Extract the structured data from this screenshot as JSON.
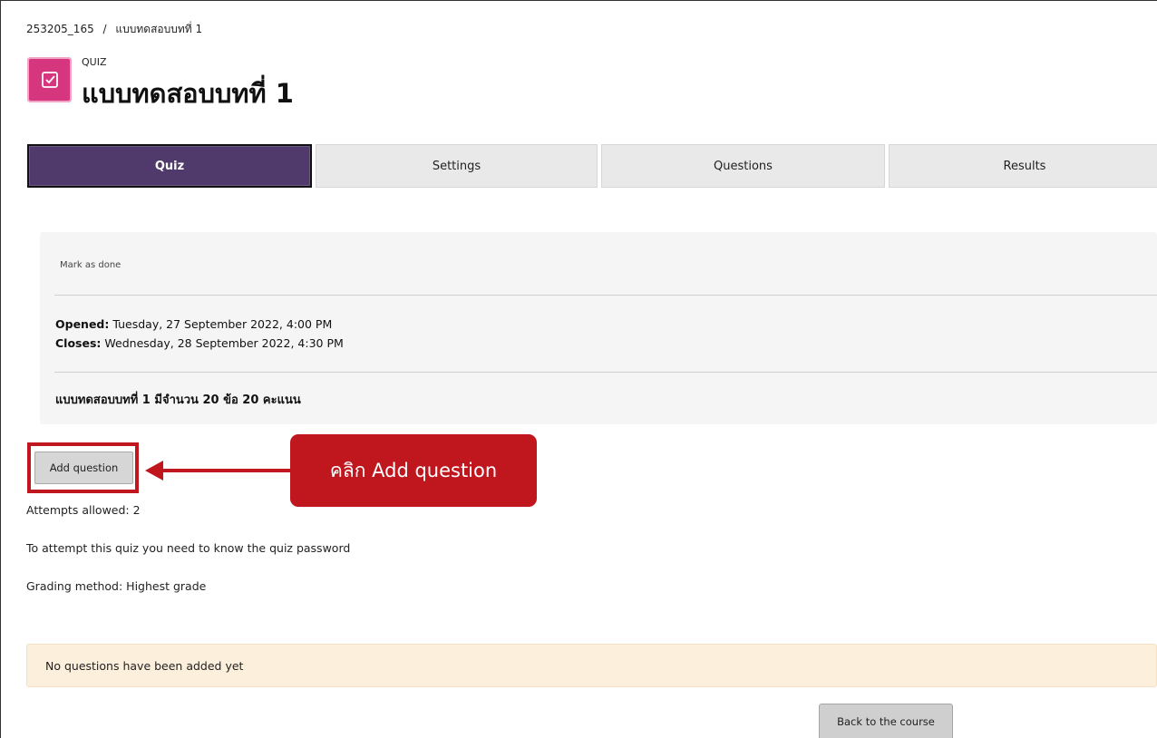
{
  "breadcrumb": {
    "course": "253205_165",
    "separator": "/",
    "current": "แบบทดสอบบทที่ 1"
  },
  "header": {
    "icon": "checkbox-icon",
    "activity_type": "QUIZ",
    "title": "แบบทดสอบบทที่ 1"
  },
  "tabs": [
    {
      "label": "Quiz",
      "active": true
    },
    {
      "label": "Settings",
      "active": false
    },
    {
      "label": "Questions",
      "active": false
    },
    {
      "label": "Results",
      "active": false
    }
  ],
  "info": {
    "mark_done": "Mark as done",
    "opened_label": "Opened:",
    "opened_value": "Tuesday, 27 September 2022, 4:00 PM",
    "closes_label": "Closes:",
    "closes_value": "Wednesday, 28 September 2022, 4:30 PM",
    "description": "แบบทดสอบบทที่ 1 มีจำนวน 20 ข้อ 20 คะแนน"
  },
  "actions": {
    "add_question": "Add question",
    "back_to_course": "Back to the course"
  },
  "callout": {
    "text": "คลิก Add question",
    "color": "#c0161e"
  },
  "quiz_meta": {
    "attempts": "Attempts allowed: 2",
    "password": "To attempt this quiz you need to know the quiz password",
    "grading": "Grading method: Highest grade"
  },
  "notice": "No questions have been added yet",
  "colors": {
    "active_tab": "#4f3a6b",
    "quiz_icon": "#d6367e",
    "notice_bg": "#fcefdc"
  }
}
